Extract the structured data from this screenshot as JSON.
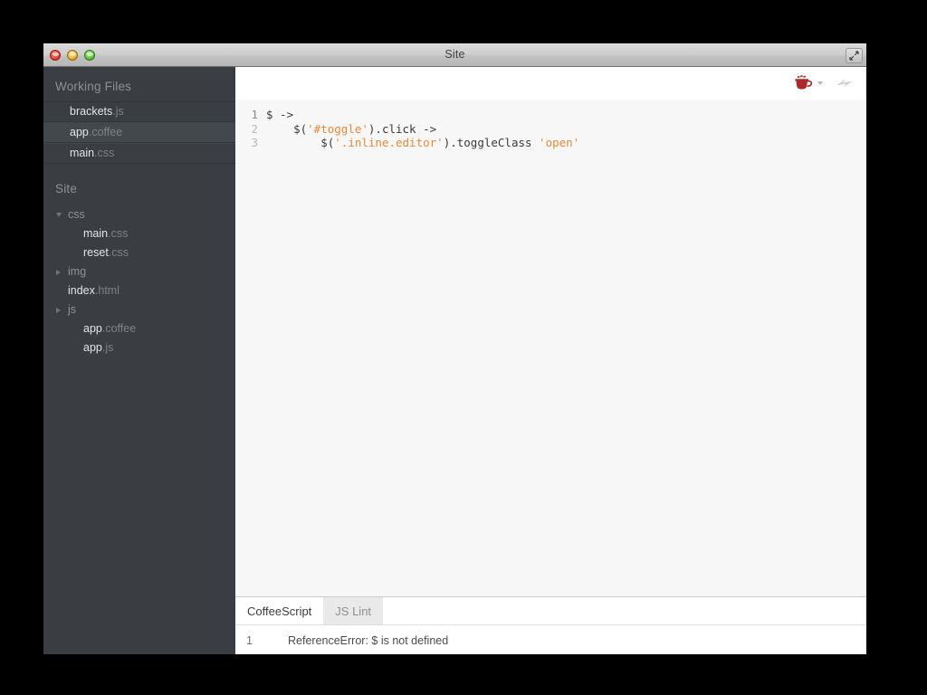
{
  "window": {
    "title": "Site",
    "controls": {
      "close": "close-button",
      "minimize": "minimize-button",
      "zoom": "zoom-button",
      "fullscreen": "fullscreen-button"
    }
  },
  "sidebar": {
    "working_files": {
      "header": "Working Files",
      "items": [
        {
          "base": "brackets",
          "ext": ".js",
          "selected": false
        },
        {
          "base": "app",
          "ext": ".coffee",
          "selected": true
        },
        {
          "base": "main",
          "ext": ".css",
          "selected": false
        }
      ]
    },
    "project": {
      "header": "Site",
      "tree": [
        {
          "name": "css",
          "ext": "",
          "type": "folder",
          "state": "open",
          "level": 1
        },
        {
          "name": "main",
          "ext": ".css",
          "type": "file",
          "state": "",
          "level": 2
        },
        {
          "name": "reset",
          "ext": ".css",
          "type": "file",
          "state": "",
          "level": 2
        },
        {
          "name": "img",
          "ext": "",
          "type": "folder",
          "state": "closed",
          "level": 1
        },
        {
          "name": "index",
          "ext": ".html",
          "type": "file",
          "state": "",
          "level": 1
        },
        {
          "name": "js",
          "ext": "",
          "type": "folder",
          "state": "closed",
          "level": 1
        },
        {
          "name": "app",
          "ext": ".coffee",
          "type": "file",
          "state": "",
          "level": 2
        },
        {
          "name": "app",
          "ext": ".js",
          "type": "file",
          "state": "",
          "level": 2
        }
      ]
    }
  },
  "toolbar": {
    "coffee_icon": "coffee-cup-icon",
    "coffee_caret": "chevron-down-icon",
    "live_preview_icon": "lightning-bolt-icon"
  },
  "editor": {
    "lines": [
      {
        "number": "1",
        "active": true,
        "tokens": [
          {
            "t": "$ ->",
            "k": "code"
          }
        ]
      },
      {
        "number": "2",
        "active": false,
        "tokens": [
          {
            "t": "    $(",
            "k": "code"
          },
          {
            "t": "'#toggle'",
            "k": "str"
          },
          {
            "t": ").click ->",
            "k": "code"
          }
        ]
      },
      {
        "number": "3",
        "active": false,
        "tokens": [
          {
            "t": "        $(",
            "k": "code"
          },
          {
            "t": "'.inline.editor'",
            "k": "str"
          },
          {
            "t": ").toggleClass ",
            "k": "code"
          },
          {
            "t": "'open'",
            "k": "str"
          }
        ]
      }
    ]
  },
  "panel": {
    "tabs": [
      {
        "label": "CoffeeScript",
        "active": true
      },
      {
        "label": "JS Lint",
        "active": false
      }
    ],
    "rows": [
      {
        "num": "1",
        "message": "ReferenceError: $ is not defined"
      }
    ]
  },
  "colors": {
    "sidebar_bg": "#3a3e42",
    "sidebar_selected": "#43484d",
    "editor_bg": "#f7f7f7",
    "string_orange": "#e8883a",
    "coffee_red": "#a82a2a"
  }
}
